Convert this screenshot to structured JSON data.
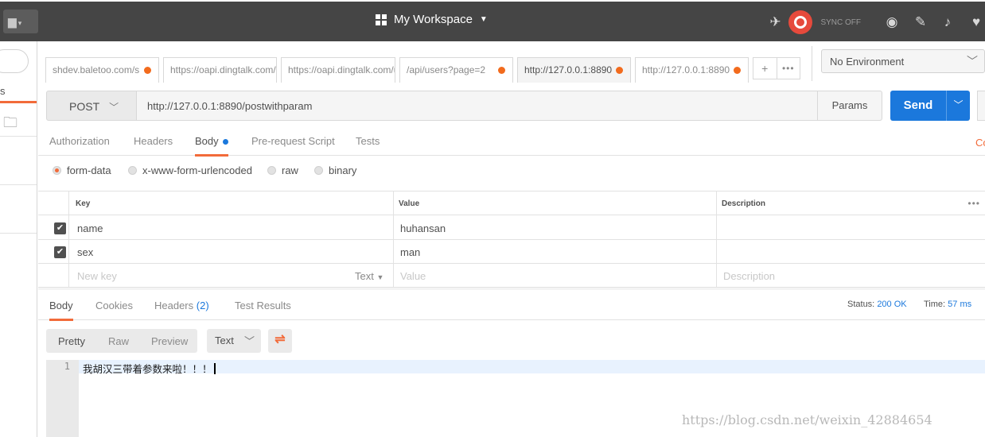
{
  "header": {
    "workspace_label": "My Workspace",
    "sync_label": "SYNC OFF",
    "icons": [
      "new-icon",
      "grid-icon",
      "satellite-icon",
      "sync-icon",
      "globe-icon",
      "wrench-icon",
      "bell-icon",
      "heart-icon"
    ]
  },
  "sidebar": {
    "tab_label": "s",
    "icons": [
      "search-icon",
      "new-folder-icon"
    ]
  },
  "tabs": [
    {
      "label": "shdev.baletoo.com/s"
    },
    {
      "label": "https://oapi.dingtalk.com/g"
    },
    {
      "label": "https://oapi.dingtalk.com/u"
    },
    {
      "label": "/api/users?page=2"
    },
    {
      "label": "http://127.0.0.1:8890"
    },
    {
      "label": "http://127.0.0.1:8890"
    }
  ],
  "tab_actions": {
    "add": "+",
    "more": "•••"
  },
  "environment": {
    "selected": "No Environment"
  },
  "request": {
    "method": "POST",
    "url": "http://127.0.0.1:8890/postwithparam",
    "params_label": "Params",
    "send_label": "Send",
    "cookies_edge": "Co"
  },
  "request_tabs": [
    "Authorization",
    "Headers",
    "Body",
    "Pre-request Script",
    "Tests"
  ],
  "body_modes": [
    "form-data",
    "x-www-form-urlencoded",
    "raw",
    "binary"
  ],
  "params_table": {
    "headers": {
      "key": "Key",
      "value": "Value",
      "description": "Description"
    },
    "rows": [
      {
        "key": "name",
        "value": "huhansan",
        "description": ""
      },
      {
        "key": "sex",
        "value": "man",
        "description": ""
      }
    ],
    "new_row": {
      "key_placeholder": "New key",
      "type": "Text",
      "value_placeholder": "Value",
      "description_placeholder": "Description"
    }
  },
  "response": {
    "tabs": {
      "body": "Body",
      "cookies": "Cookies",
      "headers": "Headers",
      "headers_count": "(2)",
      "tests": "Test Results"
    },
    "status_label": "Status:",
    "status_value": "200 OK",
    "time_label": "Time:",
    "time_value": "57 ms",
    "formats": [
      "Pretty",
      "Raw",
      "Preview"
    ],
    "format_type": "Text",
    "line_number": "1",
    "body_text": "我胡汉三带着参数来啦！！！"
  },
  "watermark": "https://blog.csdn.net/weixin_42884654",
  "colors": {
    "accent": "#f26b3a",
    "primary": "#1b78dc",
    "header_bg": "#454545",
    "tab_dot": "#f26b1d"
  }
}
